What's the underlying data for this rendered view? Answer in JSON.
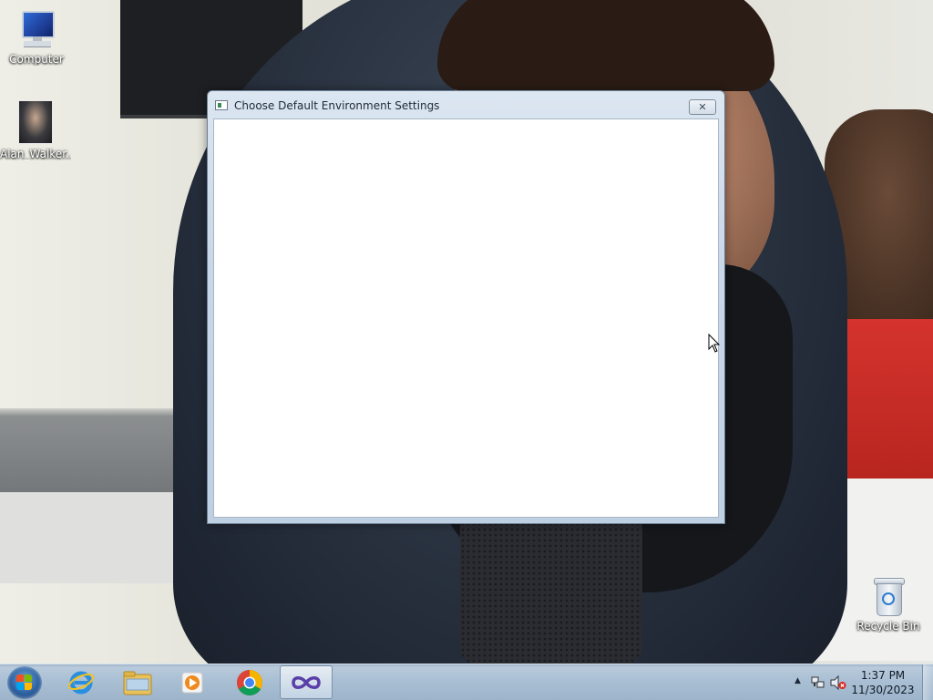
{
  "desktop": {
    "icons": [
      {
        "label": "Computer"
      },
      {
        "label": "Alan_Walker..."
      },
      {
        "label": "Recycle Bin"
      }
    ]
  },
  "window": {
    "title": "Choose Default Environment Settings",
    "close_symbol": "✕"
  },
  "taskbar": {
    "pinned": [
      {
        "name": "internet-explorer-icon"
      },
      {
        "name": "file-explorer-icon"
      },
      {
        "name": "media-player-icon"
      },
      {
        "name": "chrome-icon"
      },
      {
        "name": "visual-studio-icon",
        "active": true
      }
    ],
    "tray": {
      "show_hidden_symbol": "▲",
      "time": "1:37 PM",
      "date": "11/30/2023"
    }
  },
  "colors": {
    "taskbar": "#a8bed3",
    "window_frame": "#c9d8e8",
    "client_background": "#ffffff"
  }
}
